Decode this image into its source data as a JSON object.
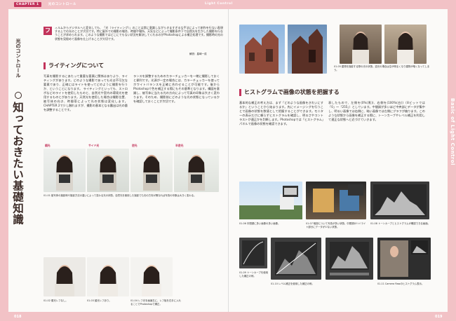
{
  "header": {
    "chapter": "CHAPTER 1",
    "chapter_title": "光のコントロール",
    "section_en": "Light Control"
  },
  "left": {
    "side_small": "光のコントロール",
    "side_big": "知っておきたい基礎知識",
    "intro_initial": "フ",
    "intro": "ィルムからデジタルへと変化しても、「光（ライティング）」のことは常に意識しながらきますぎるな手法によって創作を行ない表現する上での光のことが大切です。特に屋外での撮影の場合、時間や場所、天気などによって撮影条件下で自然光を生かした撮影を行なうことが求められます。このような撮影ではどこにでもない状況を解決してくれるのがPhotoshopによる補正処理です。撮影時の光の状態を見極めて画像を仕上げることが大切です。",
    "byline": "解説：星崎一成",
    "heading": "ライティングについて",
    "col1": "写真を撮影するにあたって重要な要素に関係はありより、ライティングがあります。どのような撮影であっても光は不可欠な要素であり、正確にはライトを使ってどのように撮影を行うか、ということになります。 ライティングといっても、ストロボなどのライトを使用したものと、自然光や室内の環境光を使用するものとがあります。天然光を使用した場合は撮影位置、被写体の向き、時間帯によって光の状態は変化します。CHAPTER 2で少し触れますが、撮影の基本となる露出は光の量を調整することです。",
    "col2": "ランスを調整するためのカラーチェッカーを一緒に撮影しておくと便利です。光源が一定の場合には、カラーチェッカーを使ってホワイトバランスを正確に合わせることが可能です。後からPhotoshopで色を補正する際にもその基準となります。構図を意識し、被写体に当たる光の方向によって写真の印象は大きく変わります。そのため、撮影前にどのような光の状態になっているかを確認しておくことが大切です。",
    "labels": [
      "順光",
      "サイド光",
      "逆光",
      "半逆光"
    ],
    "caption_row": "01-01 被写体の撮影時や撮影方法の違いによって変わる光の状態。自然光を使用した撮影でも光の方向が異なれば写真の印象は大きく変わる。",
    "captions": [
      "01-02 順光レフなし。",
      "01-03 顔光レフあり。",
      "01-04 レフ光を画面右に、レフ板を右手に入れることでPhotoshopで補正。"
    ]
  },
  "right": {
    "top_caption": "01-05 建物を撮影する際の光の状態。逆光の場合は空が明るくなり建物が暗くなってしまう。",
    "heading": "ヒストグラムで画像の状態を把握する",
    "col1": "基本的な補正の考え方は、まず「どのような画像をきれいにするか」ということから始まります。先にイメージングを行うことで画像の状態を数値として把握することができます。モニターの表示だけに頼らずヒストグラムを確認し、明るさやコントラストが適正かを判断します。Photoshopでは「ヒストグラム」パネルで画像の状態を確認できます。",
    "col2": "表したもので、左側を(0%(黒))、右側を(100%(白))（8ビットでは「0」〜「255」）としています。中間調が多いほど中央部にデータが集中し、明るい画像では右側に、暗い画像では左側にグラフが偏ります。このような状態から画像を補正する際に、トーンカーブやレベル補正を利用して適正な状態へと近づけていきます。",
    "captions": [
      "01-06 中間調に多い画像の多い画像。",
      "01-07 暗部について写真が多い状態。中間調がハイライト部分にデータが少ない状態。",
      "01-08 トーンカーブとヒストグラムが確認できる画面。"
    ],
    "captions2": [
      "01-09 トーンカーブを使用した補正の例。",
      "01-10 レベル補正を使用した補正の例。",
      "01-11 Camera Rawのヒストグラム表示。"
    ]
  },
  "side_label": "Basic of Light Control",
  "page_left": "018",
  "page_right": "019",
  "accent": "#c2335b"
}
